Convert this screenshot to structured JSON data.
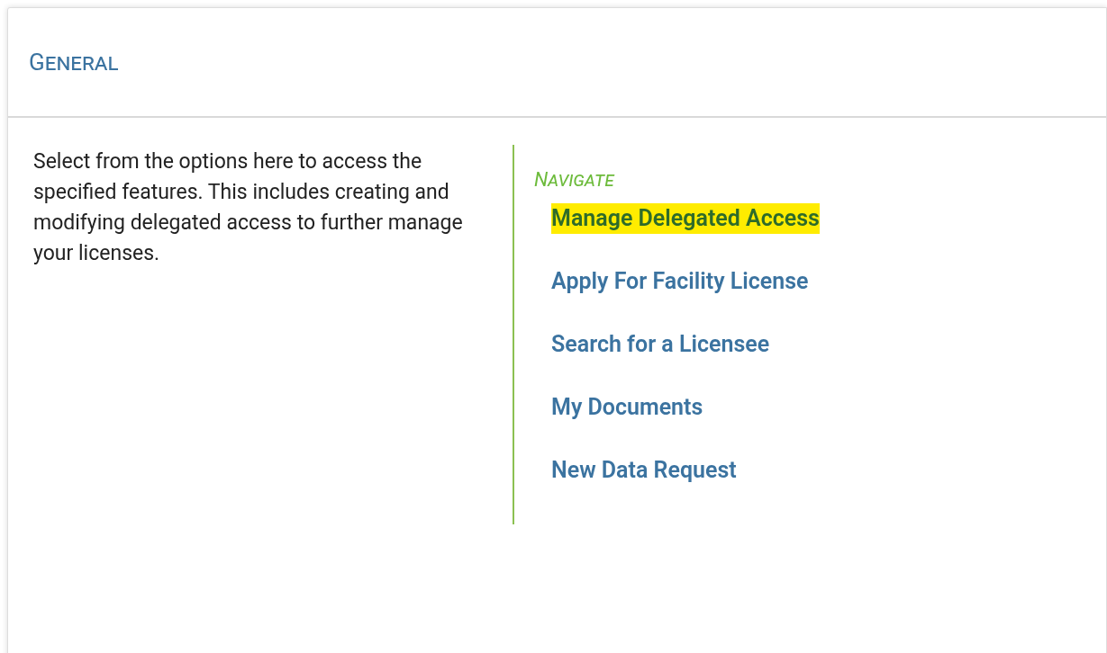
{
  "panel": {
    "title": "General"
  },
  "description": "Select from the options here to access the specified features. This includes creating and modifying delegated access to further manage your licenses.",
  "navigate": {
    "heading": "Navigate",
    "items": [
      {
        "label": "Manage Delegated Access",
        "selected": true
      },
      {
        "label": "Apply For Facility License",
        "selected": false
      },
      {
        "label": "Search for a Licensee",
        "selected": false
      },
      {
        "label": "My Documents",
        "selected": false
      },
      {
        "label": "New Data Request",
        "selected": false
      }
    ]
  }
}
